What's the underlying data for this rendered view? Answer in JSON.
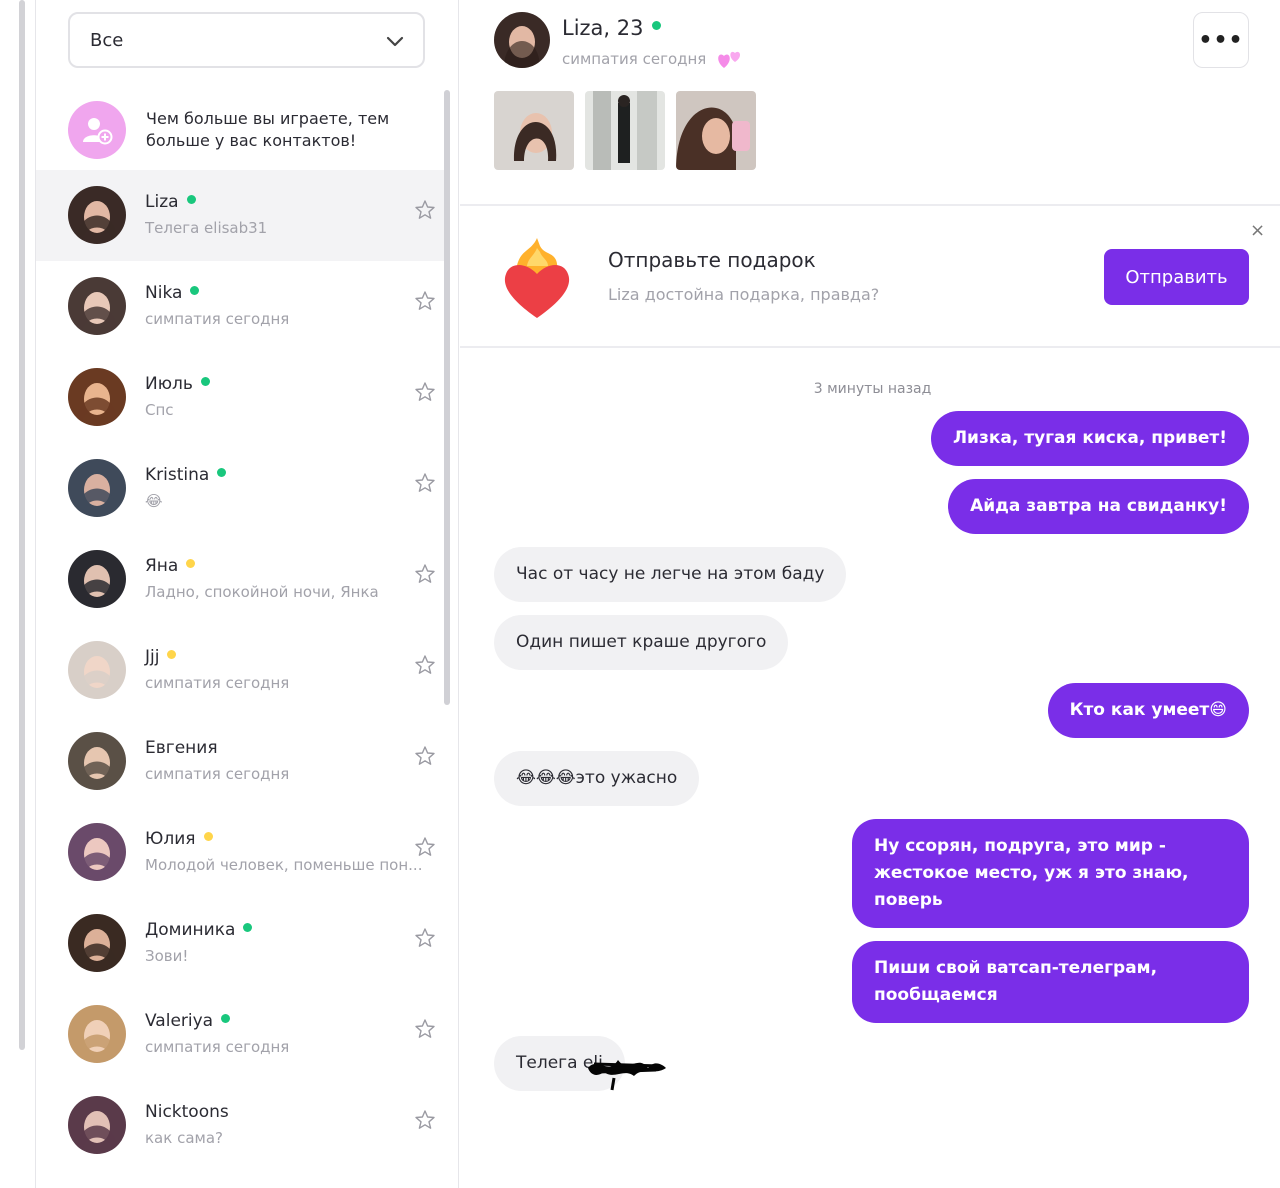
{
  "filter": {
    "selected": "Все"
  },
  "promo": {
    "text": "Чем больше вы играете, тем больше у вас контактов!"
  },
  "contacts": [
    {
      "name": "Liza",
      "status": "online",
      "subtitle": "Телега elisab31",
      "active": true
    },
    {
      "name": "Nika",
      "status": "online",
      "subtitle": "симпатия сегодня"
    },
    {
      "name": "Июль",
      "status": "online",
      "subtitle": "Спс"
    },
    {
      "name": "Kristina",
      "status": "online",
      "subtitle": "😂"
    },
    {
      "name": "Яна",
      "status": "away",
      "subtitle": "Ладно, спокойной ночи, Янка"
    },
    {
      "name": "Jjj",
      "status": "away",
      "subtitle": "симпатия сегодня"
    },
    {
      "name": "Евгения",
      "status": "none",
      "subtitle": "симпатия сегодня"
    },
    {
      "name": "Юлия",
      "status": "away",
      "subtitle": "Молодой человек, поменьше пон..."
    },
    {
      "name": "Доминика",
      "status": "online",
      "subtitle": "Зови!"
    },
    {
      "name": "Valeriya",
      "status": "online",
      "subtitle": "симпатия сегодня"
    },
    {
      "name": "Nicktoons",
      "status": "none",
      "subtitle": "как сама?"
    }
  ],
  "chat_header": {
    "name": "Liza, 23",
    "status": "online",
    "subtitle": "симпатия сегодня",
    "more_label": "•••"
  },
  "gift": {
    "title": "Отправьте подарок",
    "subtitle": "Liza достойна подарка, правда?",
    "button": "Отправить",
    "close": "×"
  },
  "messages": {
    "timestamp": "3 минуты назад",
    "items": [
      {
        "dir": "out",
        "text": "Лизка, тугая киска, привет!"
      },
      {
        "dir": "out",
        "text": "Айда завтра на свиданку!"
      },
      {
        "dir": "in",
        "text": "Час от часу не легче на этом баду"
      },
      {
        "dir": "in",
        "text": "Один пишет краше другого"
      },
      {
        "dir": "out",
        "text": "Кто как умеет😄"
      },
      {
        "dir": "in",
        "text": "😂😂😂это ужасно"
      },
      {
        "dir": "out",
        "text": "Ну ссорян, подруга, это мир - жестокое место, уж я это знаю, поверь"
      },
      {
        "dir": "out",
        "text": "Пиши свой ватсап-телеграм, пообщаемся"
      },
      {
        "dir": "in",
        "text": "Телега eli"
      }
    ]
  },
  "colors": {
    "accent": "#7a2ee8",
    "online": "#19c77d",
    "away": "#ffd54a",
    "promo": "#f0a6ee"
  }
}
